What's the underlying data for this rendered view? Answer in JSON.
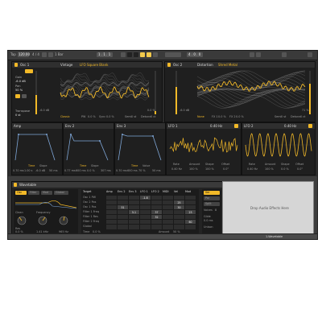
{
  "toolbar": {
    "tap": "Tap",
    "tempo": "120.00",
    "meter": "4 / 4",
    "quant": "1 Bar",
    "position": "1 . 1 . 1",
    "loop_end": "4 . 0 . 0"
  },
  "osc1": {
    "title": "Osc 1",
    "wavetable_category": "Vintage",
    "wavetable_name": "LFO Square Blank",
    "gain_label": "Gain",
    "gain_value": "-6.0 dB",
    "pan_label": "Pan",
    "pan_value": "50 %",
    "transpose_label": "Transpose",
    "transpose_value": "0 st",
    "fx_mode": "Classic",
    "pw_label": "PW",
    "pw_value": "0.0 %",
    "sync_label": "Sync",
    "sync_value": "0.0 %",
    "semi_label": "Semi",
    "semi_value": "0 st",
    "detune_label": "Detune",
    "detune_value": "0 ct",
    "gain_left": "-6.0 dB",
    "pos_right": "0.0 %"
  },
  "osc2": {
    "title": "Osc 2",
    "wavetable_category": "Distortion",
    "wavetable_name": "Shred Metal",
    "fx_mode": "None",
    "fx1_label": "FX 1",
    "fx1_value": "0.0 %",
    "fx2_label": "FX 2",
    "fx2_value": "0.0 %",
    "semi_label": "Semi",
    "semi_value": "0 st",
    "detune_label": "Detune",
    "detune_value": "0 ct",
    "gain_left": "-6.0 dB",
    "pos_right": "71 %"
  },
  "envelopes": [
    {
      "title": "Amp",
      "mode": "Time",
      "shape": "Slope",
      "attack": "0.70 ms",
      "decay": "1.00 s",
      "sustain": "-6.0 dB",
      "release": "50 ms"
    },
    {
      "title": "Env 2",
      "mode": "Time",
      "shape": "Slope",
      "attack": "0.77 ms",
      "decay": "600 ms",
      "sustain": "0.0 %",
      "release": "307 ms"
    },
    {
      "title": "Env 3",
      "mode": "Time",
      "shape": "Value",
      "attack": "0.70 ms",
      "decay": "600 ms",
      "sustain": "70 %",
      "release": "50 ms"
    }
  ],
  "lfos": [
    {
      "title": "LFO 1",
      "rate": "0.40 Hz",
      "rate_label": "Rate",
      "amount_label": "Amount",
      "amount": "100 %",
      "shape_label": "Shape",
      "shape": "100 %",
      "offset_label": "Offset",
      "offset": "0.0°"
    },
    {
      "title": "LFO 2",
      "rate": "0.40 Hz",
      "rate_label": "Rate",
      "amount_label": "Amount",
      "amount": "100 %",
      "shape_label": "Shape",
      "shape": "0.0 %",
      "offset_label": "Offset",
      "offset": "0.0°"
    }
  ],
  "device": {
    "title": "Wavetable",
    "tabs": [
      "Osc",
      "Filter",
      "Mod",
      "Global"
    ],
    "filter_type": "Clean",
    "frequency_label": "Frequency",
    "frequency_value": "1.41 kHz",
    "res_label": "Res",
    "res_value": "0.0 %",
    "freq2_value": "965 Hz",
    "mode_options": [
      "Ser",
      "Par",
      "Split"
    ],
    "matrix_title": "Target",
    "matrix_cols": [
      "Amp",
      "Env 2",
      "Env 3",
      "LFO 1",
      "LFO 2",
      "MIDI",
      "Vel",
      "Mod"
    ],
    "matrix_rows": [
      "Osc 1 PW",
      "Osc 2 Pos",
      "Osc 1 Pos",
      "Filter 1 Freq",
      "Filter 1 Res",
      "Filter 2 Freq",
      "Global"
    ],
    "cells": [
      [
        "",
        "",
        "",
        "-1.8",
        "",
        "",
        "",
        ""
      ],
      [
        "",
        "",
        "",
        "",
        "",
        "",
        "25",
        ""
      ],
      [
        "",
        "51",
        "",
        "",
        "",
        "",
        "30",
        ""
      ],
      [
        "",
        "",
        "5.1",
        "",
        "37",
        "",
        "",
        "23"
      ],
      [
        "",
        "",
        "",
        "",
        "32",
        "",
        "",
        ""
      ],
      [
        "",
        "",
        "",
        "",
        "",
        "",
        "",
        "60"
      ],
      [
        "",
        "",
        "",
        "",
        "",
        "",
        "",
        ""
      ]
    ],
    "time_label": "Time",
    "time_value": "0.0 %",
    "amount_label": "Amount",
    "amount_value": "50 %",
    "voices_label": "Voices",
    "voices_value": "8",
    "glide_label": "Glide",
    "glide_value": "0.0 ms",
    "unison_label": "Unison"
  },
  "drop_text": "Drop Audio Effects Here",
  "status": {
    "track": "1-Wavetable"
  },
  "colors": {
    "accent": "#f2b928",
    "panel": "#1f1f1f",
    "chrome": "#2b2b2b"
  }
}
